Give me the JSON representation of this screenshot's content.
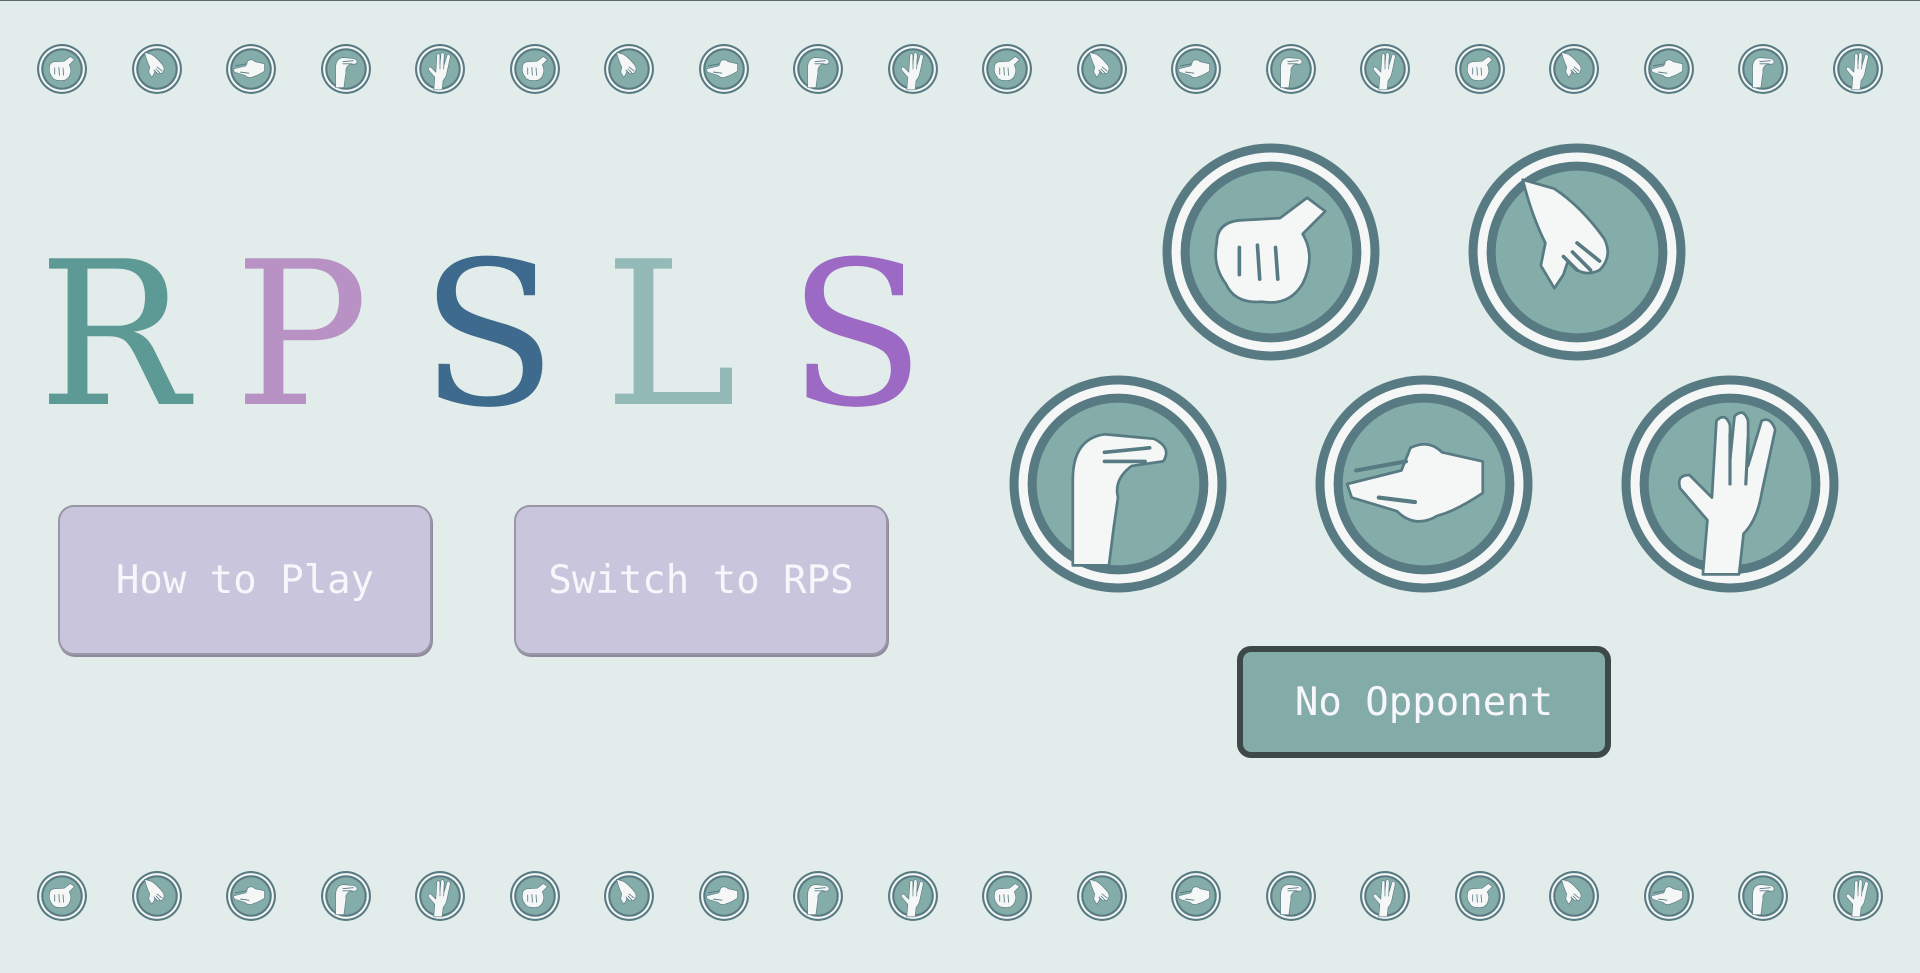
{
  "title": {
    "letters": [
      {
        "char": "R",
        "color": "#5d9995"
      },
      {
        "char": "P",
        "color": "#b892c4"
      },
      {
        "char": "S",
        "color": "#3e6a8e"
      },
      {
        "char": "L",
        "color": "#93bab6"
      },
      {
        "char": "S",
        "color": "#9c6ac4"
      }
    ]
  },
  "buttons": {
    "how_to_play": "How to Play",
    "switch_mode": "Switch to RPS",
    "opponent": "No Opponent"
  },
  "choices": [
    "rock-icon",
    "paper-icon",
    "lizard-icon",
    "scissors-icon",
    "spock-icon"
  ],
  "decor_strip": [
    "rock-icon",
    "paper-icon",
    "scissors-icon",
    "lizard-icon",
    "spock-icon"
  ],
  "colors": {
    "background": "#e2edeb",
    "ring": "#587a82",
    "inner": "#84aca9",
    "hand": "#f4f7f6",
    "menu_button": "#c9c5dc",
    "opponent_button": "#83aca9"
  }
}
